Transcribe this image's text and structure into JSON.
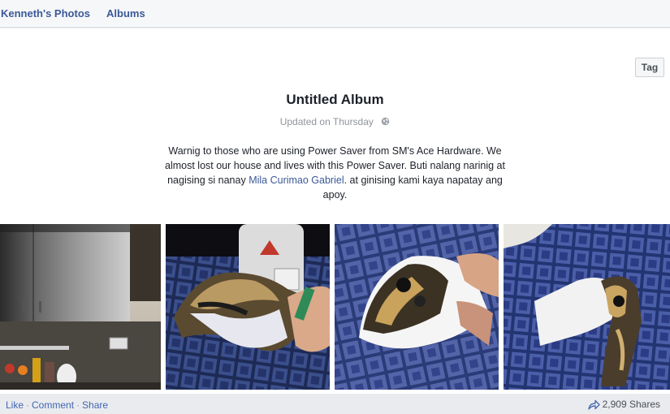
{
  "nav": {
    "owner_photos": "Kenneth's Photos",
    "albums": "Albums"
  },
  "album": {
    "tag_label": "Tag",
    "title": "Untitled Album",
    "updated": "Updated on Thursday",
    "privacy_icon": "globe-icon",
    "description": {
      "part1": "Warnig to those who are using Power Saver from SM's Ace Hardware. We almost lost our house and lives with this Power Saver. Buti nalang narinig at nagising si nanay",
      "mention": "Mila Curimao Gabriel",
      "part2": ". at ginising kami kaya napatay ang apoy."
    }
  },
  "photos": [
    {
      "name": "photo-kitchen-cabinet"
    },
    {
      "name": "photo-burnt-power-saver-held"
    },
    {
      "name": "photo-burnt-device-on-floor"
    },
    {
      "name": "photo-burnt-device-closeup"
    }
  ],
  "footer": {
    "like": "Like",
    "comment": "Comment",
    "share": "Share",
    "separator": "·",
    "shares_count": "2,909 Shares",
    "share_icon": "share-arrow-icon"
  },
  "colors": {
    "link": "#3b5998",
    "background": "#e9ebee",
    "card": "#ffffff"
  }
}
